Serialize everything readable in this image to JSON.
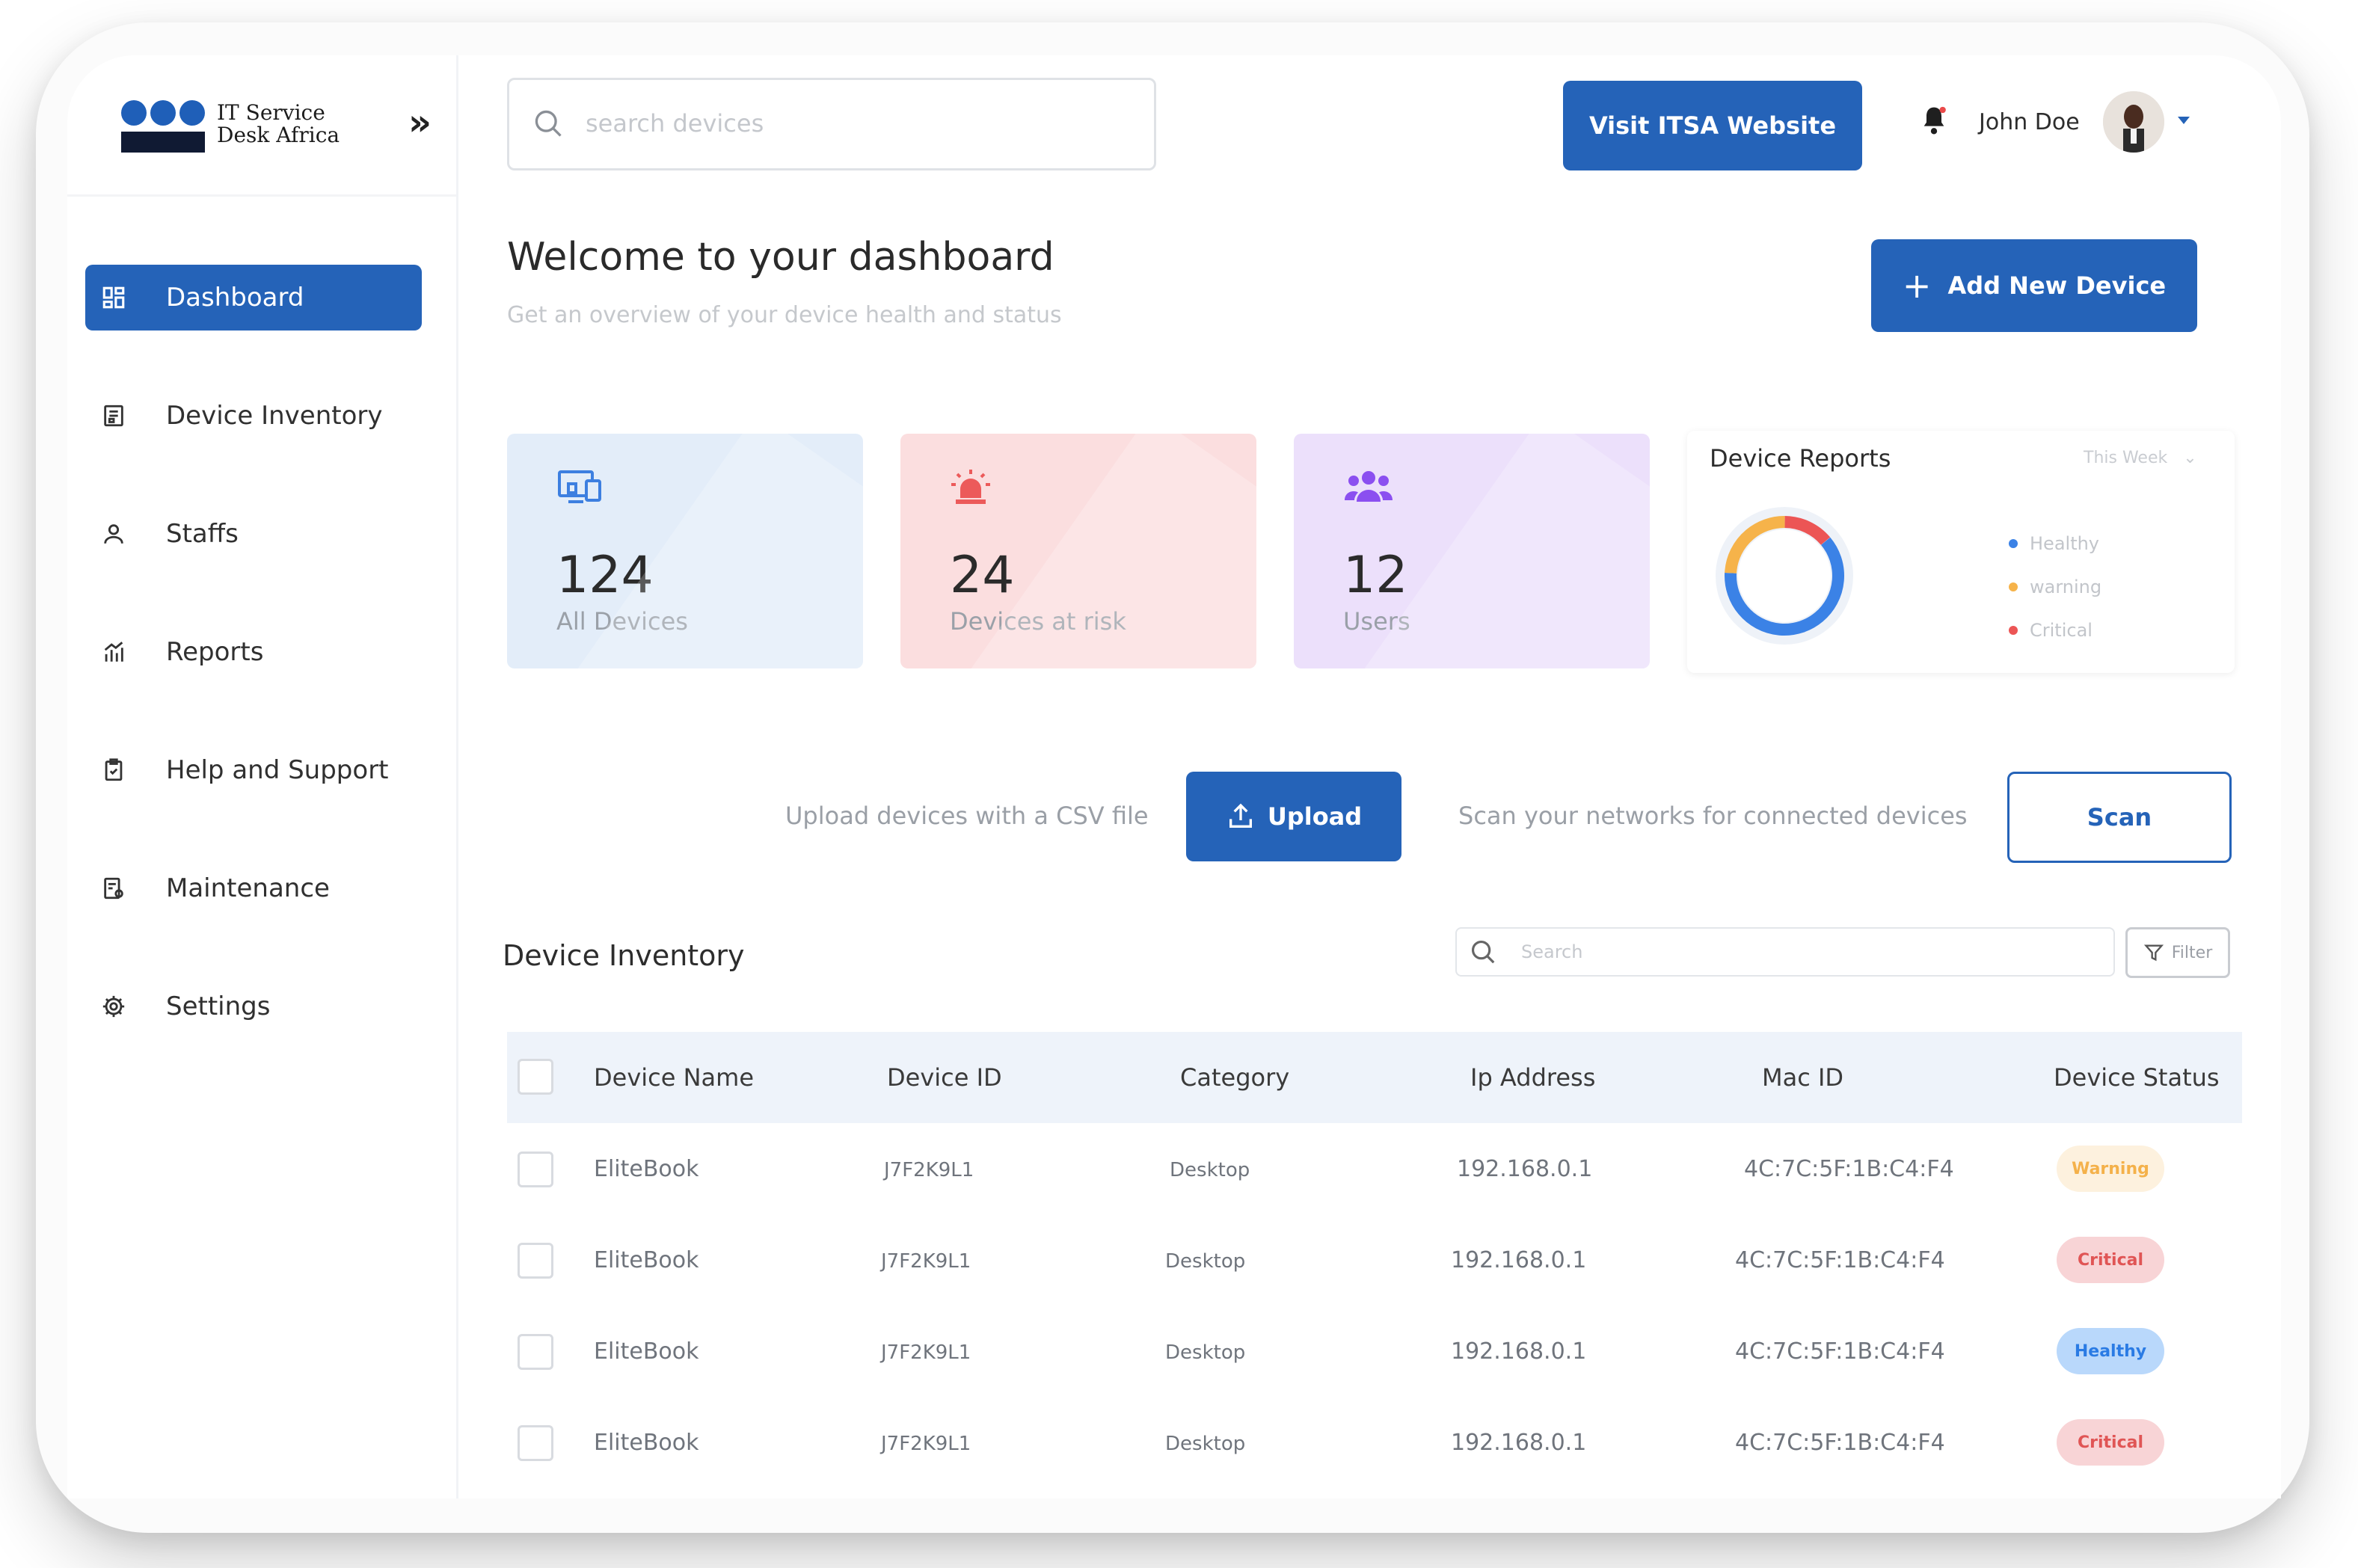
{
  "brand": {
    "name": "IT Service Desk Africa"
  },
  "sidebar": {
    "items": [
      {
        "label": "Dashboard",
        "active": true
      },
      {
        "label": "Device Inventory"
      },
      {
        "label": "Staffs"
      },
      {
        "label": "Reports"
      },
      {
        "label": "Help and Support"
      },
      {
        "label": "Maintenance"
      },
      {
        "label": "Settings"
      }
    ]
  },
  "header": {
    "search_placeholder": "search devices",
    "visit_label": "Visit ITSA Website",
    "user_name": "John Doe"
  },
  "page": {
    "title": "Welcome to your dashboard",
    "subtitle": "Get an overview of your device health and status",
    "add_device_label": "Add New Device"
  },
  "stats": [
    {
      "value": "124",
      "label": "All Devices"
    },
    {
      "value": "24",
      "label": "Devices at risk"
    },
    {
      "value": "12",
      "label": "Users"
    }
  ],
  "reports": {
    "title": "Device Reports",
    "period": "This Week",
    "legend": [
      {
        "label": "Healthy",
        "color": "#3b82e6"
      },
      {
        "label": "warning",
        "color": "#f6b34a"
      },
      {
        "label": "Critical",
        "color": "#ec5555"
      }
    ]
  },
  "actions": {
    "upload_text": "Upload devices with a CSV file",
    "upload_label": "Upload",
    "scan_text": "Scan your networks for connected devices",
    "scan_label": "Scan"
  },
  "inventory": {
    "title": "Device Inventory",
    "search_placeholder": "Search",
    "filter_label": "Filter",
    "columns": [
      "Device Name",
      "Device ID",
      "Category",
      "Ip Address",
      "Mac ID",
      "Device Status"
    ],
    "rows": [
      {
        "name": "EliteBook",
        "id": "J7F2K9L1",
        "category": "Desktop",
        "ip": "192.168.0.1",
        "mac": "4C:7C:5F:1B:C4:F4",
        "status": "Warning"
      },
      {
        "name": "EliteBook",
        "id": "J7F2K9L1",
        "category": "Desktop",
        "ip": "192.168.0.1",
        "mac": "4C:7C:5F:1B:C4:F4",
        "status": "Critical"
      },
      {
        "name": "EliteBook",
        "id": "J7F2K9L1",
        "category": "Desktop",
        "ip": "192.168.0.1",
        "mac": "4C:7C:5F:1B:C4:F4",
        "status": "Healthy"
      },
      {
        "name": "EliteBook",
        "id": "J7F2K9L1",
        "category": "Desktop",
        "ip": "192.168.0.1",
        "mac": "4C:7C:5F:1B:C4:F4",
        "status": "Critical"
      }
    ]
  },
  "colors": {
    "primary": "#2563b8",
    "warning_bg": "#fdf1de",
    "warning_fg": "#f4b14a",
    "critical_bg": "#f8d4d6",
    "critical_fg": "#e05555",
    "healthy_bg": "#b9d8fb",
    "healthy_fg": "#2a7be4"
  }
}
